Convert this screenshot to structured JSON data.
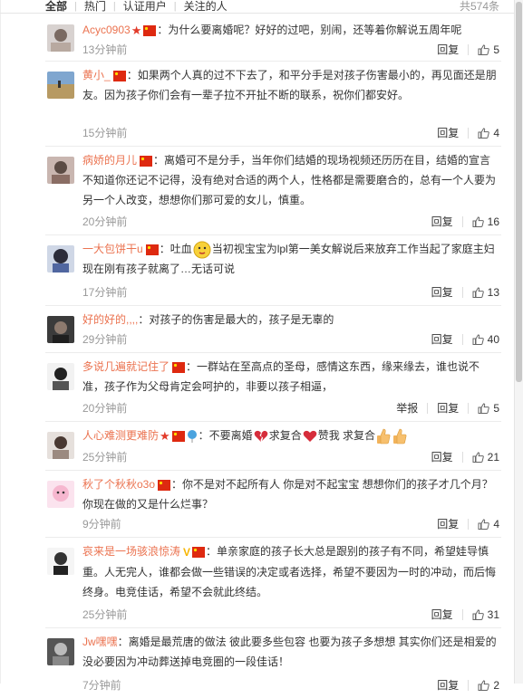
{
  "tabs": [
    {
      "label": "全部",
      "active": true
    },
    {
      "label": "热门",
      "active": false
    },
    {
      "label": "认证用户",
      "active": false
    },
    {
      "label": "关注的人",
      "active": false
    }
  ],
  "total": "共574条",
  "reply_label": "回复",
  "report_label": "举报",
  "comments": [
    {
      "user": "Acyc0903",
      "text": "：为什么要离婚呢？好好的过吧，别闹，还等着你解说五周年呢",
      "time": "13分钟前",
      "likes": "5"
    },
    {
      "user": "黄小_",
      "text": "：如果两个人真的过不下去了，和平分手是对孩子伤害最小的，再见面还是朋友。因为孩子你们会有一辈子拉不开扯不断的联系，祝你们都安好。",
      "time": "15分钟前",
      "likes": "4"
    },
    {
      "user": "病娇的月儿",
      "text": "：离婚可不是分手，当年你们结婚的现场视频还历历在目，结婚的宣言不知道你还记不记得，没有绝对合适的两个人，性格都是需要磨合的，总有一个人要为另一个人改变，想想你们那可爱的女儿，慎重。",
      "time": "20分钟前",
      "likes": "16"
    },
    {
      "user": "一大包饼干u",
      "text_a": "：吐血",
      "text_b": "当初视宝宝为lpl第一美女解说后来放弃工作当起了家庭主妇现在刚有孩子就离了…无话可说",
      "time": "17分钟前",
      "likes": "13"
    },
    {
      "user": "好的好的,,,,",
      "text": "：对孩子的伤害是最大的，孩子是无辜的",
      "time": "29分钟前",
      "likes": "40"
    },
    {
      "user": "多说几遍就记住了",
      "text": "：一群站在至高点的圣母，感情这东西，缘来缘去，谁也说不准，孩子作为父母肯定会呵护的，非要以孩子相逼，",
      "time": "20分钟前",
      "likes": "5"
    },
    {
      "user": "人心难测更难防",
      "text_a": "：不要离婚",
      "text_b": "求复合",
      "text_c": "赞我 求复合",
      "time": "25分钟前",
      "likes": "21"
    },
    {
      "user": "秋了个秋秋o3o",
      "text": "：你不是对不起所有人 你是对不起宝宝 想想你们的孩子才几个月？你现在做的又是什么烂事？",
      "time": "9分钟前",
      "likes": "4"
    },
    {
      "user": "哀来是一场骇浪惊涛",
      "text": "：单亲家庭的孩子长大总是跟别的孩子有不同，希望娃导慎重。人无完人，谁都会做一些错误的决定或者选择，希望不要因为一时的冲动，而后悔终身。电竞佳话，希望不会就此终结。",
      "time": "25分钟前",
      "likes": "31"
    },
    {
      "user": "Jw嘿嘿",
      "text": "：离婚是最荒唐的做法 彼此要多些包容 也要为孩子多想想 其实你们还是相爱的 没必要因为冲动葬送掉电竞圈的一段佳话！",
      "time": "7分钟前",
      "likes": "2"
    }
  ]
}
